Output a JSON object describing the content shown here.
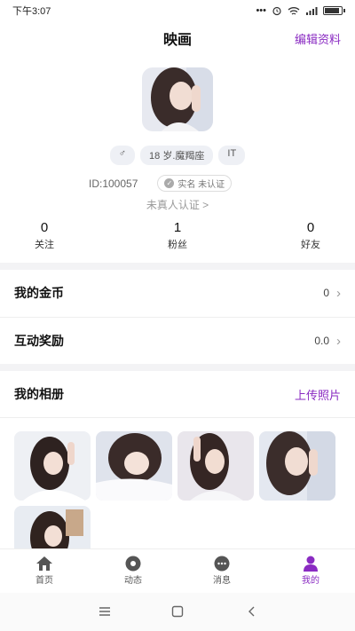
{
  "status": {
    "time": "下午3:07",
    "dots": "•••"
  },
  "header": {
    "title": "映画",
    "edit_label": "编辑资料"
  },
  "profile": {
    "tags": [
      "♂",
      "18 岁.魔羯座",
      "IT"
    ],
    "id_text": "ID:100057",
    "realname_label": "实名 未认证",
    "verify_text": "未真人认证 >"
  },
  "stats": [
    {
      "value": "0",
      "label": "关注"
    },
    {
      "value": "1",
      "label": "粉丝"
    },
    {
      "value": "0",
      "label": "好友"
    }
  ],
  "rows": [
    {
      "label": "我的金币",
      "value": "0"
    },
    {
      "label": "互动奖励",
      "value": "0.0"
    }
  ],
  "album": {
    "title": "我的相册",
    "upload_label": "上传照片"
  },
  "tabs": [
    {
      "label": "首页",
      "icon": "home-icon"
    },
    {
      "label": "动态",
      "icon": "disc-icon"
    },
    {
      "label": "消息",
      "icon": "chat-icon"
    },
    {
      "label": "我的",
      "icon": "person-icon"
    }
  ],
  "colors": {
    "accent": "#8a2bc2",
    "gray_bg": "#f3f3f5"
  }
}
